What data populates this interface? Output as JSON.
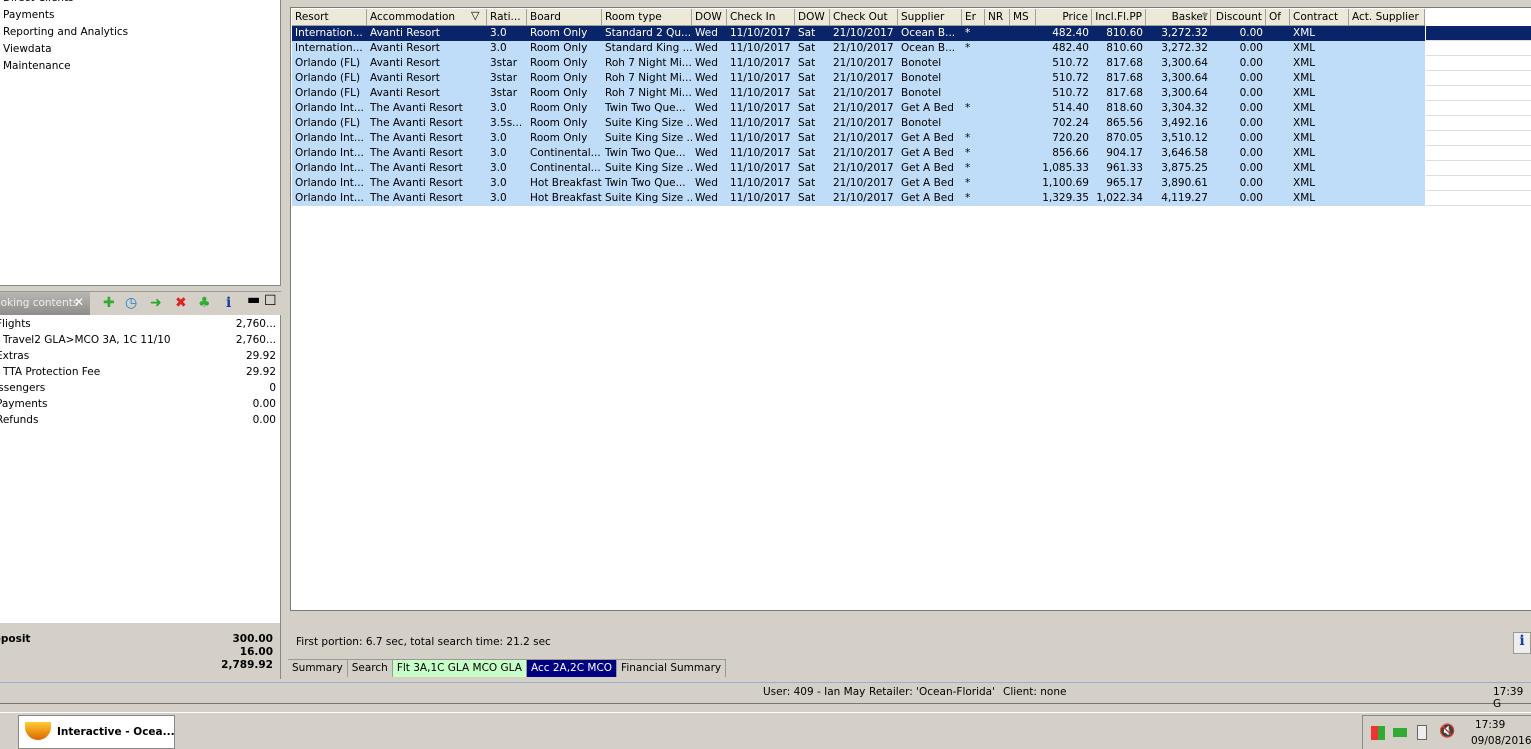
{
  "nav": {
    "items": [
      "Direct Clients",
      "Payments",
      "Reporting and Analytics",
      "Viewdata",
      "Maintenance"
    ]
  },
  "booking": {
    "tab_label": "Booking contents",
    "toolbar_icons": [
      "add-icon",
      "clock-icon",
      "cart-arrow-icon",
      "delete-icon",
      "palm-tree-icon",
      "info-icon",
      "minimize-icon",
      "maximize-icon"
    ],
    "rows": [
      {
        "label": "Flights",
        "value": "2,760..."
      },
      {
        "label": "Travel2 GLA>MCO  3A, 1C 11/10",
        "value": "2,760..."
      },
      {
        "label": "Extras",
        "value": "29.92"
      },
      {
        "label": "TTA Protection Fee",
        "value": "29.92"
      },
      {
        "label": "Passengers",
        "value": "0"
      },
      {
        "label": "Payments",
        "value": "0.00"
      },
      {
        "label": "Refunds",
        "value": "0.00"
      }
    ],
    "totals": [
      {
        "label": "Deposit",
        "value": "300.00"
      },
      {
        "label": "",
        "value": "16.00"
      },
      {
        "label": "",
        "value": "2,789.92"
      }
    ]
  },
  "grid": {
    "columns": [
      "Resort",
      "Accommodation",
      "Rati...",
      "Board",
      "Room type",
      "DOW",
      "Check In",
      "DOW",
      "Check Out",
      "Supplier",
      "Er",
      "NR",
      "MS",
      "Price",
      "Incl.Fl.PP",
      "Basket",
      "Discount",
      "Of",
      "Contract",
      "Act. Supplier"
    ],
    "selected_row": 0,
    "rows": [
      [
        "Internation...",
        "Avanti Resort",
        "3.0",
        "Room Only",
        "Standard 2 Qu...",
        "Wed",
        "11/10/2017",
        "Sat",
        "21/10/2017",
        "Ocean B...",
        "*",
        "",
        "",
        "482.40",
        "810.60",
        "3,272.32",
        "0.00",
        "",
        "XML",
        ""
      ],
      [
        "Internation...",
        "Avanti Resort",
        "3.0",
        "Room Only",
        "Standard King ...",
        "Wed",
        "11/10/2017",
        "Sat",
        "21/10/2017",
        "Ocean B...",
        "*",
        "",
        "",
        "482.40",
        "810.60",
        "3,272.32",
        "0.00",
        "",
        "XML",
        ""
      ],
      [
        "Orlando (FL)",
        "Avanti Resort",
        "3star",
        "Room Only",
        "Roh 7 Night Mi...",
        "Wed",
        "11/10/2017",
        "Sat",
        "21/10/2017",
        "Bonotel",
        "",
        "",
        "",
        "510.72",
        "817.68",
        "3,300.64",
        "0.00",
        "",
        "XML",
        ""
      ],
      [
        "Orlando (FL)",
        "Avanti Resort",
        "3star",
        "Room Only",
        "Roh 7 Night Mi...",
        "Wed",
        "11/10/2017",
        "Sat",
        "21/10/2017",
        "Bonotel",
        "",
        "",
        "",
        "510.72",
        "817.68",
        "3,300.64",
        "0.00",
        "",
        "XML",
        ""
      ],
      [
        "Orlando (FL)",
        "Avanti Resort",
        "3star",
        "Room Only",
        "Roh 7 Night Mi...",
        "Wed",
        "11/10/2017",
        "Sat",
        "21/10/2017",
        "Bonotel",
        "",
        "",
        "",
        "510.72",
        "817.68",
        "3,300.64",
        "0.00",
        "",
        "XML",
        ""
      ],
      [
        "Orlando Int...",
        "The Avanti Resort",
        "3.0",
        "Room Only",
        "Twin Two Que...",
        "Wed",
        "11/10/2017",
        "Sat",
        "21/10/2017",
        "Get A Bed",
        "*",
        "",
        "",
        "514.40",
        "818.60",
        "3,304.32",
        "0.00",
        "",
        "XML",
        ""
      ],
      [
        "Orlando (FL)",
        "The Avanti Resort",
        "3.5s...",
        "Room Only",
        "Suite King Size ...",
        "Wed",
        "11/10/2017",
        "Sat",
        "21/10/2017",
        "Bonotel",
        "",
        "",
        "",
        "702.24",
        "865.56",
        "3,492.16",
        "0.00",
        "",
        "XML",
        ""
      ],
      [
        "Orlando Int...",
        "The Avanti Resort",
        "3.0",
        "Room Only",
        "Suite King Size ...",
        "Wed",
        "11/10/2017",
        "Sat",
        "21/10/2017",
        "Get A Bed",
        "*",
        "",
        "",
        "720.20",
        "870.05",
        "3,510.12",
        "0.00",
        "",
        "XML",
        ""
      ],
      [
        "Orlando Int...",
        "The Avanti Resort",
        "3.0",
        "Continental...",
        "Twin Two Que...",
        "Wed",
        "11/10/2017",
        "Sat",
        "21/10/2017",
        "Get A Bed",
        "*",
        "",
        "",
        "856.66",
        "904.17",
        "3,646.58",
        "0.00",
        "",
        "XML",
        ""
      ],
      [
        "Orlando Int...",
        "The Avanti Resort",
        "3.0",
        "Continental...",
        "Suite King Size ...",
        "Wed",
        "11/10/2017",
        "Sat",
        "21/10/2017",
        "Get A Bed",
        "*",
        "",
        "",
        "1,085.33",
        "961.33",
        "3,875.25",
        "0.00",
        "",
        "XML",
        ""
      ],
      [
        "Orlando Int...",
        "The Avanti Resort",
        "3.0",
        "Hot Breakfast",
        "Twin Two Que...",
        "Wed",
        "11/10/2017",
        "Sat",
        "21/10/2017",
        "Get A Bed",
        "*",
        "",
        "",
        "1,100.69",
        "965.17",
        "3,890.61",
        "0.00",
        "",
        "XML",
        ""
      ],
      [
        "Orlando Int...",
        "The Avanti Resort",
        "3.0",
        "Hot Breakfast",
        "Suite King Size ...",
        "Wed",
        "11/10/2017",
        "Sat",
        "21/10/2017",
        "Get A Bed",
        "*",
        "",
        "",
        "1,329.35",
        "1,022.34",
        "4,119.27",
        "0.00",
        "",
        "XML",
        ""
      ]
    ]
  },
  "search_info": "First portion: 6.7 sec, total search time: 21.2 sec",
  "tabs": [
    {
      "label": "Summary"
    },
    {
      "label": "Search"
    },
    {
      "label": "Flt 3A,1C GLA MCO GLA",
      "color": "#c8ffc8"
    },
    {
      "label": "Acc 2A,2C MCO",
      "color": "#000080",
      "active": true
    },
    {
      "label": "Financial Summary"
    }
  ],
  "status": {
    "user": "User: 409 - Ian May",
    "retailer": "Retailer: 'Ocean-Florida'",
    "client": "Client: none",
    "time": "17:39 G"
  },
  "taskbar": {
    "app": "Interactive - Ocea...",
    "clock_time": "17:39",
    "clock_date": "09/08/2016"
  }
}
